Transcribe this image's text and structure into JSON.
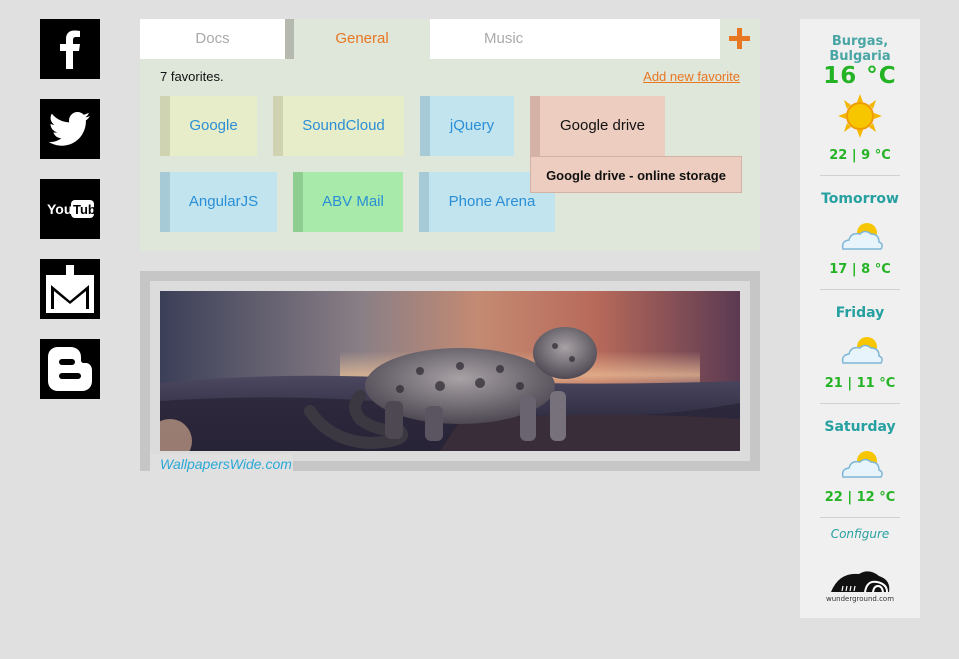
{
  "social": [
    {
      "name": "facebook",
      "icon": "facebook-icon"
    },
    {
      "name": "twitter",
      "icon": "twitter-icon"
    },
    {
      "name": "youtube",
      "icon": "youtube-icon",
      "label": "You Tube"
    },
    {
      "name": "gmail",
      "icon": "mail-download-icon"
    },
    {
      "name": "blogger",
      "icon": "blogger-icon"
    }
  ],
  "tabs": [
    {
      "label": "Docs",
      "active": false
    },
    {
      "label": "General",
      "active": true
    },
    {
      "label": "Music",
      "active": false
    }
  ],
  "favorites": {
    "count_text": "7 favorites.",
    "add_label": "Add new favorite",
    "items": [
      {
        "label": "Google",
        "color": "yellow"
      },
      {
        "label": "SoundCloud",
        "color": "yellow"
      },
      {
        "label": "jQuery",
        "color": "blue"
      },
      {
        "label": "Google drive",
        "color": "pink"
      },
      {
        "label": "AngularJS",
        "color": "blue"
      },
      {
        "label": "ABV Mail",
        "color": "green"
      },
      {
        "label": "Phone Arena",
        "color": "blue"
      }
    ],
    "tooltip": "Google drive - online storage"
  },
  "wallpaper": {
    "caption": "WallpapersWide.com"
  },
  "weather": {
    "city": "Burgas, Bulgaria",
    "current_temp": "16 °C",
    "current_icon": "sun-icon",
    "today_range": "22 | 9 °C",
    "forecast": [
      {
        "day": "Tomorrow",
        "icon": "partly-cloudy-icon",
        "range": "17 | 8 °C"
      },
      {
        "day": "Friday",
        "icon": "partly-cloudy-icon",
        "range": "21 | 11 °C"
      },
      {
        "day": "Saturday",
        "icon": "partly-cloudy-icon",
        "range": "22 | 12 °C"
      }
    ],
    "configure_label": "Configure",
    "logo_text": "wunderground.com"
  },
  "colors": {
    "accent": "#e87722",
    "link": "#2a8fd6",
    "weather_green": "#24b324",
    "weather_teal": "#26a0a0"
  }
}
